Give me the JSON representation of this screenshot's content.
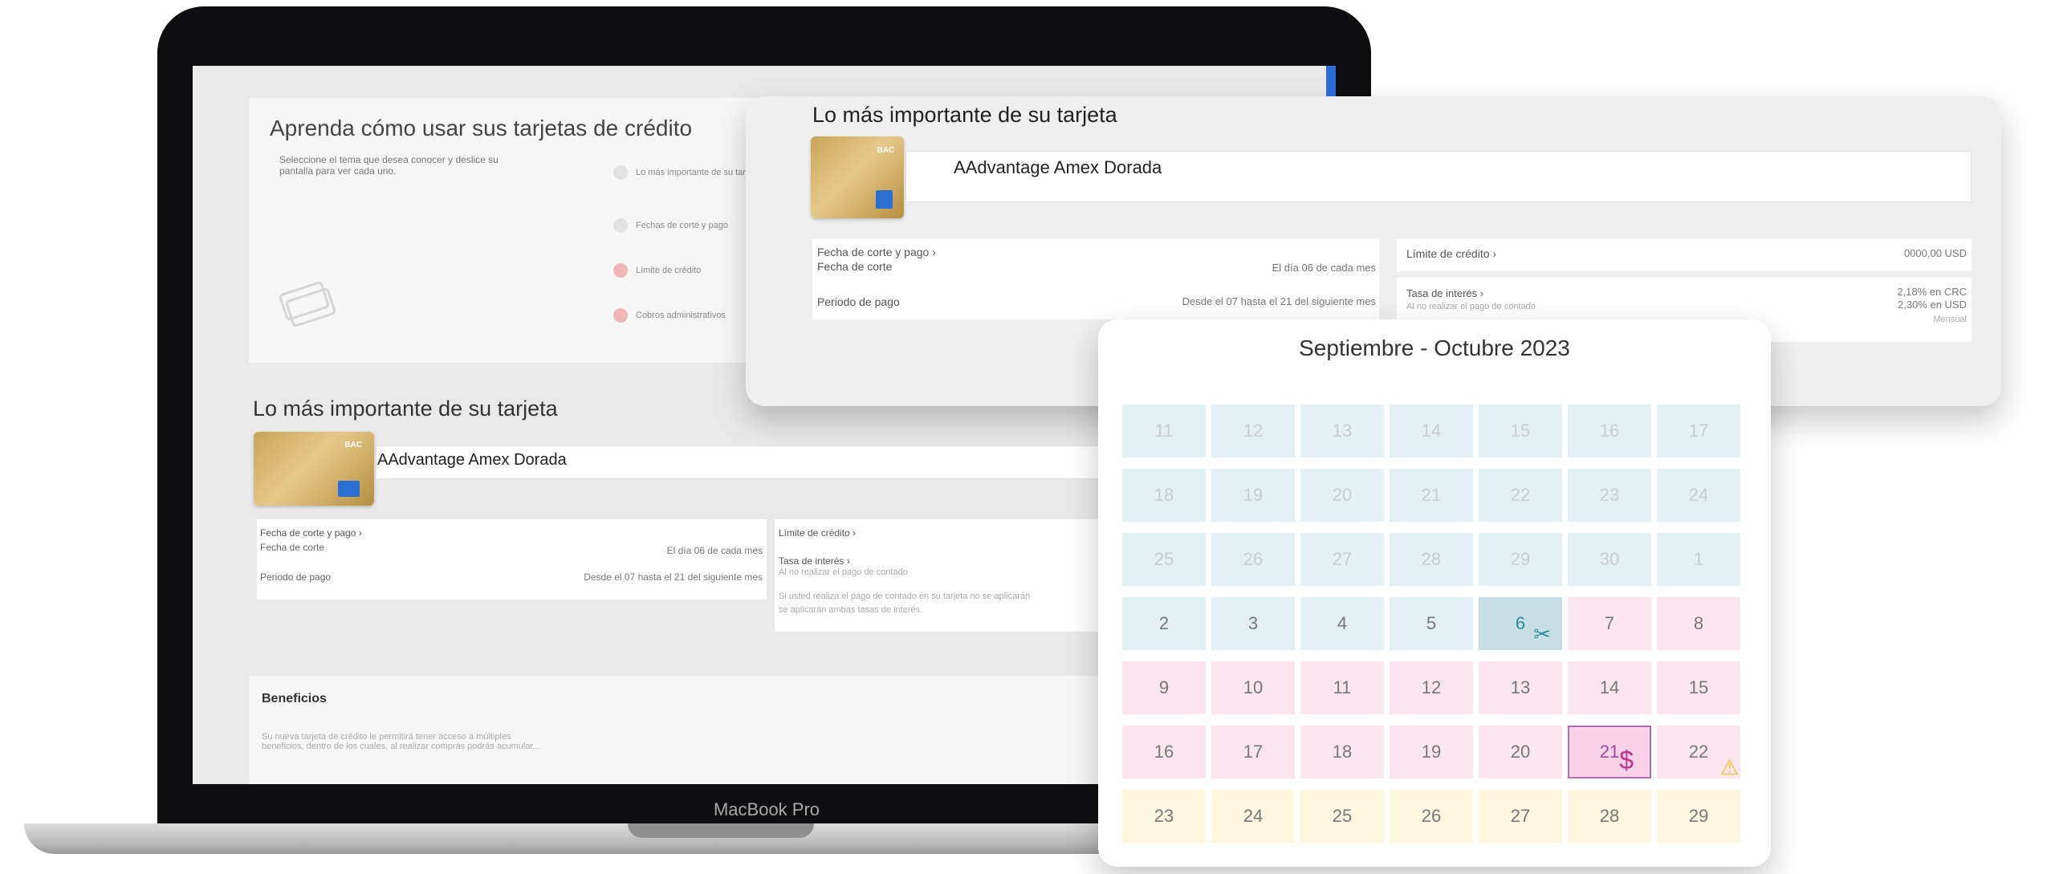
{
  "laptop": {
    "brand": "MacBook Pro",
    "learn": {
      "title": "Aprenda cómo usar sus tarjetas de crédito",
      "intro": "Seleccione el tema que desea conocer y deslice su pantalla para ver cada uno.",
      "topics": [
        "Lo más importante de su tarjeta",
        "Fechas de corte y pago",
        "Límite de crédito",
        "Cobros administrativos"
      ]
    },
    "important": {
      "title": "Lo más importante de su tarjeta",
      "card_name": "AAdvantage Amex Dorada",
      "card_ticker": "BAC",
      "fecha_corte_pago": "Fecha de corte y pago ›",
      "fecha_corte": "Fecha de corte",
      "fecha_corte_val": "El día 06 de cada mes",
      "periodo_pago": "Periodo de pago",
      "periodo_pago_val": "Desde el 07 hasta el 21 del siguiente mes",
      "limite": "Límite de crédito ›",
      "tasa": "Tasa de interés ›",
      "tasa_note": "Al no realizar el pago de contado",
      "tasa_note2": "Si usted realiza el pago de contado en su tarjeta no se aplicarán",
      "tasa_note3": "se aplicarán ambas tasas de interés."
    },
    "benefits": {
      "title": "Beneficios",
      "text": "Su nueva tarjeta de crédito le permitirá tener acceso a múltiples beneficios, dentro de los cuales, al realizar compras podrás acumular..."
    }
  },
  "float_card": {
    "title": "Lo más importante de su tarjeta",
    "card_name": "AAdvantage Amex Dorada",
    "card_ticker": "BAC",
    "fecha_corte_pago": "Fecha de corte y pago ›",
    "fecha_corte": "Fecha de corte",
    "fecha_corte_val": "El día 06 de cada mes",
    "periodo_pago": "Periodo de pago",
    "periodo_pago_val": "Desde el 07 hasta el 21 del siguiente mes",
    "limite": "Límite de crédito ›",
    "limite_val": "0000,00 USD",
    "tasa": "Tasa de interés ›",
    "tasa_note": "Al no realizar el pago de contado",
    "tasa_crc": "2,18% en CRC",
    "tasa_usd": "2,30% en USD",
    "tasa_freq": "Mensual"
  },
  "calendar": {
    "title": "Septiembre - Octubre 2023",
    "rows": [
      [
        {
          "d": "11",
          "c": "blue",
          "f": true
        },
        {
          "d": "12",
          "c": "blue",
          "f": true
        },
        {
          "d": "13",
          "c": "blue",
          "f": true
        },
        {
          "d": "14",
          "c": "blue",
          "f": true
        },
        {
          "d": "15",
          "c": "blue",
          "f": true
        },
        {
          "d": "16",
          "c": "blue",
          "f": true
        },
        {
          "d": "17",
          "c": "blue",
          "f": true
        }
      ],
      [
        {
          "d": "18",
          "c": "blue",
          "f": true
        },
        {
          "d": "19",
          "c": "blue",
          "f": true
        },
        {
          "d": "20",
          "c": "blue",
          "f": true
        },
        {
          "d": "21",
          "c": "blue",
          "f": true
        },
        {
          "d": "22",
          "c": "blue",
          "f": true
        },
        {
          "d": "23",
          "c": "blue",
          "f": true
        },
        {
          "d": "24",
          "c": "blue",
          "f": true
        }
      ],
      [
        {
          "d": "25",
          "c": "blue",
          "f": true
        },
        {
          "d": "26",
          "c": "blue",
          "f": true
        },
        {
          "d": "27",
          "c": "blue",
          "f": true
        },
        {
          "d": "28",
          "c": "blue",
          "f": true
        },
        {
          "d": "29",
          "c": "blue",
          "f": true
        },
        {
          "d": "30",
          "c": "blue",
          "f": true
        },
        {
          "d": "1",
          "c": "blue",
          "f": true
        }
      ],
      [
        {
          "d": "2",
          "c": "blue"
        },
        {
          "d": "3",
          "c": "blue"
        },
        {
          "d": "4",
          "c": "blue"
        },
        {
          "d": "5",
          "c": "blue"
        },
        {
          "d": "6",
          "c": "cut",
          "icon": "scissors-icon"
        },
        {
          "d": "7",
          "c": "pink"
        },
        {
          "d": "8",
          "c": "pink"
        }
      ],
      [
        {
          "d": "9",
          "c": "pink"
        },
        {
          "d": "10",
          "c": "pink"
        },
        {
          "d": "11",
          "c": "pink"
        },
        {
          "d": "12",
          "c": "pink"
        },
        {
          "d": "13",
          "c": "pink"
        },
        {
          "d": "14",
          "c": "pink"
        },
        {
          "d": "15",
          "c": "pink"
        }
      ],
      [
        {
          "d": "16",
          "c": "pink"
        },
        {
          "d": "17",
          "c": "pink"
        },
        {
          "d": "18",
          "c": "pink"
        },
        {
          "d": "19",
          "c": "pink"
        },
        {
          "d": "20",
          "c": "pink"
        },
        {
          "d": "21",
          "c": "pay",
          "icon": "dollar-icon"
        },
        {
          "d": "22",
          "c": "pink",
          "icon": "warning-icon"
        }
      ],
      [
        {
          "d": "23",
          "c": "yellow"
        },
        {
          "d": "24",
          "c": "yellow"
        },
        {
          "d": "25",
          "c": "yellow"
        },
        {
          "d": "26",
          "c": "yellow"
        },
        {
          "d": "27",
          "c": "yellow"
        },
        {
          "d": "28",
          "c": "yellow"
        },
        {
          "d": "29",
          "c": "yellow"
        }
      ]
    ],
    "colors": {
      "cut": "#2c8b9a",
      "pay": "#c0338a",
      "warning": "#f2c318"
    }
  }
}
